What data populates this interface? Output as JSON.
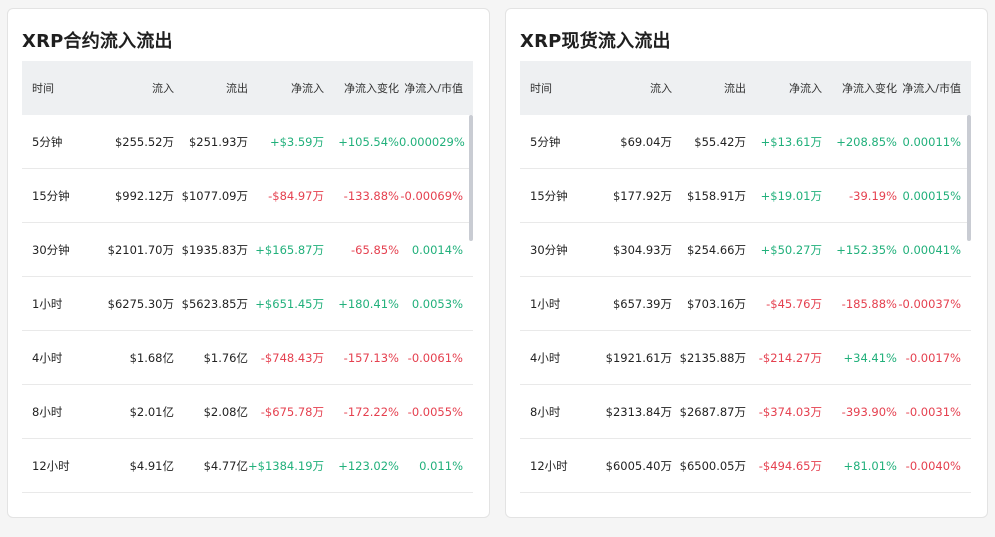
{
  "contract": {
    "title": "XRP合约流入流出",
    "headers": [
      "时间",
      "流入",
      "流出",
      "净流入",
      "净流入变化",
      "净流入/市值"
    ],
    "rows": [
      [
        "5分钟",
        "$255.52万",
        "$251.93万",
        "+$3.59万",
        "+105.54%",
        "0.000029%"
      ],
      [
        "15分钟",
        "$992.12万",
        "$1077.09万",
        "-$84.97万",
        "-133.88%",
        "-0.00069%"
      ],
      [
        "30分钟",
        "$2101.70万",
        "$1935.83万",
        "+$165.87万",
        "-65.85%",
        "0.0014%"
      ],
      [
        "1小时",
        "$6275.30万",
        "$5623.85万",
        "+$651.45万",
        "+180.41%",
        "0.0053%"
      ],
      [
        "4小时",
        "$1.68亿",
        "$1.76亿",
        "-$748.43万",
        "-157.13%",
        "-0.0061%"
      ],
      [
        "8小时",
        "$2.01亿",
        "$2.08亿",
        "-$675.78万",
        "-172.22%",
        "-0.0055%"
      ],
      [
        "12小时",
        "$4.91亿",
        "$4.77亿",
        "+$1384.19万",
        "+123.02%",
        "0.011%"
      ]
    ]
  },
  "spot": {
    "title": "XRP现货流入流出",
    "headers": [
      "时间",
      "流入",
      "流出",
      "净流入",
      "净流入变化",
      "净流入/市值"
    ],
    "rows": [
      [
        "5分钟",
        "$69.04万",
        "$55.42万",
        "+$13.61万",
        "+208.85%",
        "0.00011%"
      ],
      [
        "15分钟",
        "$177.92万",
        "$158.91万",
        "+$19.01万",
        "-39.19%",
        "0.00015%"
      ],
      [
        "30分钟",
        "$304.93万",
        "$254.66万",
        "+$50.27万",
        "+152.35%",
        "0.00041%"
      ],
      [
        "1小时",
        "$657.39万",
        "$703.16万",
        "-$45.76万",
        "-185.88%",
        "-0.00037%"
      ],
      [
        "4小时",
        "$1921.61万",
        "$2135.88万",
        "-$214.27万",
        "+34.41%",
        "-0.0017%"
      ],
      [
        "8小时",
        "$2313.84万",
        "$2687.87万",
        "-$374.03万",
        "-393.90%",
        "-0.0031%"
      ],
      [
        "12小时",
        "$6005.40万",
        "$6500.05万",
        "-$494.65万",
        "+81.01%",
        "-0.0040%"
      ]
    ]
  },
  "colors": {
    "positive": "#21b07b",
    "negative": "#e5404f",
    "header_bg": "#eef0f2"
  }
}
